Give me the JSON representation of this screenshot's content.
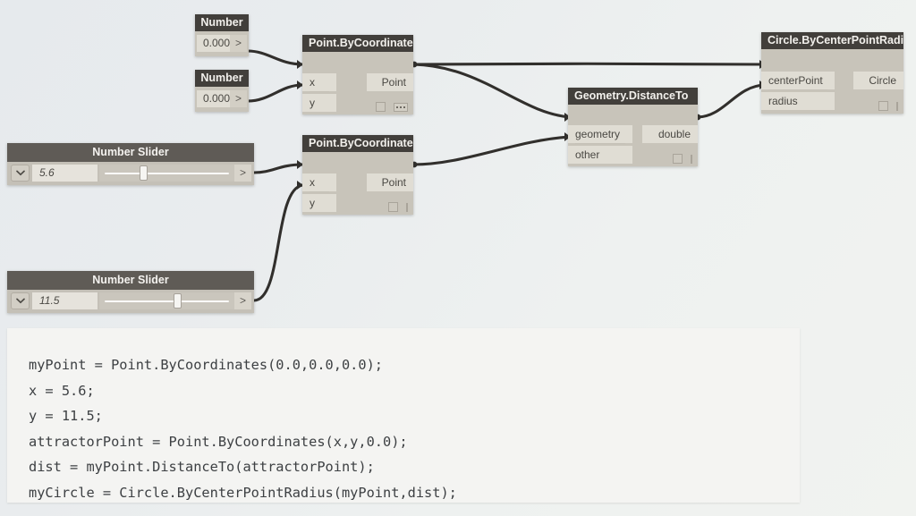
{
  "app": {
    "name": "Dynamo",
    "canvas_background_from": "#e6eaed",
    "canvas_background_to": "#f1f3f0",
    "node_header_color": "#423f3b",
    "node_body_color": "#c8c4ba",
    "port_color": "#e0ddd4",
    "wire_color": "#312f2c"
  },
  "nodes": [
    {
      "id": "number-1",
      "type": "number-input",
      "title": "Number",
      "value": "0.000",
      "caret": ">"
    },
    {
      "id": "number-2",
      "type": "number-input",
      "title": "Number",
      "value": "0.000",
      "caret": ">"
    },
    {
      "id": "point-bycoordinates-1",
      "type": "function",
      "title": "Point.ByCoordinates",
      "inputs": [
        "x",
        "y"
      ],
      "outputs": [
        "Point"
      ],
      "footer_glyphs": [
        "preview-box",
        "lacing-dots"
      ]
    },
    {
      "id": "point-bycoordinates-2",
      "type": "function",
      "title": "Point.ByCoordinates",
      "inputs": [
        "x",
        "y"
      ],
      "outputs": [
        "Point"
      ],
      "footer_glyphs": [
        "preview-box",
        "lacing-bar"
      ]
    },
    {
      "id": "geometry-distanceto",
      "type": "function",
      "title": "Geometry.DistanceTo",
      "inputs": [
        "geometry",
        "other"
      ],
      "outputs": [
        "double"
      ],
      "footer_glyphs": [
        "preview-box",
        "lacing-bar"
      ]
    },
    {
      "id": "circle-bycenterpointradius",
      "type": "function",
      "title": "Circle.ByCenterPointRadius",
      "inputs": [
        "centerPoint",
        "radius"
      ],
      "outputs": [
        "Circle"
      ],
      "footer_glyphs": [
        "preview-box",
        "lacing-bar"
      ]
    }
  ],
  "sliders": [
    {
      "id": "number-slider-x",
      "title": "Number Slider",
      "value": "5.6",
      "thumb_percent": 30,
      "caret": ">",
      "expand_icon": "chevron-down-icon"
    },
    {
      "id": "number-slider-y",
      "title": "Number Slider",
      "value": "11.5",
      "thumb_percent": 55,
      "caret": ">",
      "expand_icon": "chevron-down-icon"
    }
  ],
  "code_block": {
    "lines": [
      "myPoint = Point.ByCoordinates(0.0,0.0,0.0);",
      "x = 5.6;",
      "y = 11.5;",
      "attractorPoint = Point.ByCoordinates(x,y,0.0);",
      "dist = myPoint.DistanceTo(attractorPoint);",
      "myCircle = Circle.ByCenterPointRadius(myPoint,dist);"
    ],
    "text": "myPoint = Point.ByCoordinates(0.0,0.0,0.0);\nx = 5.6;\ny = 11.5;\nattractorPoint = Point.ByCoordinates(x,y,0.0);\ndist = myPoint.DistanceTo(attractorPoint);\nmyCircle = Circle.ByCenterPointRadius(myPoint,dist);"
  },
  "connections": [
    {
      "from": "number-1.out",
      "to": "point-bycoordinates-1.x"
    },
    {
      "from": "number-2.out",
      "to": "point-bycoordinates-1.y"
    },
    {
      "from": "number-slider-x.out",
      "to": "point-bycoordinates-2.x"
    },
    {
      "from": "number-slider-y.out",
      "to": "point-bycoordinates-2.y"
    },
    {
      "from": "point-bycoordinates-1.Point",
      "to": "circle-bycenterpointradius.centerPoint"
    },
    {
      "from": "point-bycoordinates-1.Point",
      "to": "geometry-distanceto.geometry"
    },
    {
      "from": "point-bycoordinates-2.Point",
      "to": "geometry-distanceto.other"
    },
    {
      "from": "geometry-distanceto.double",
      "to": "circle-bycenterpointradius.radius"
    }
  ]
}
